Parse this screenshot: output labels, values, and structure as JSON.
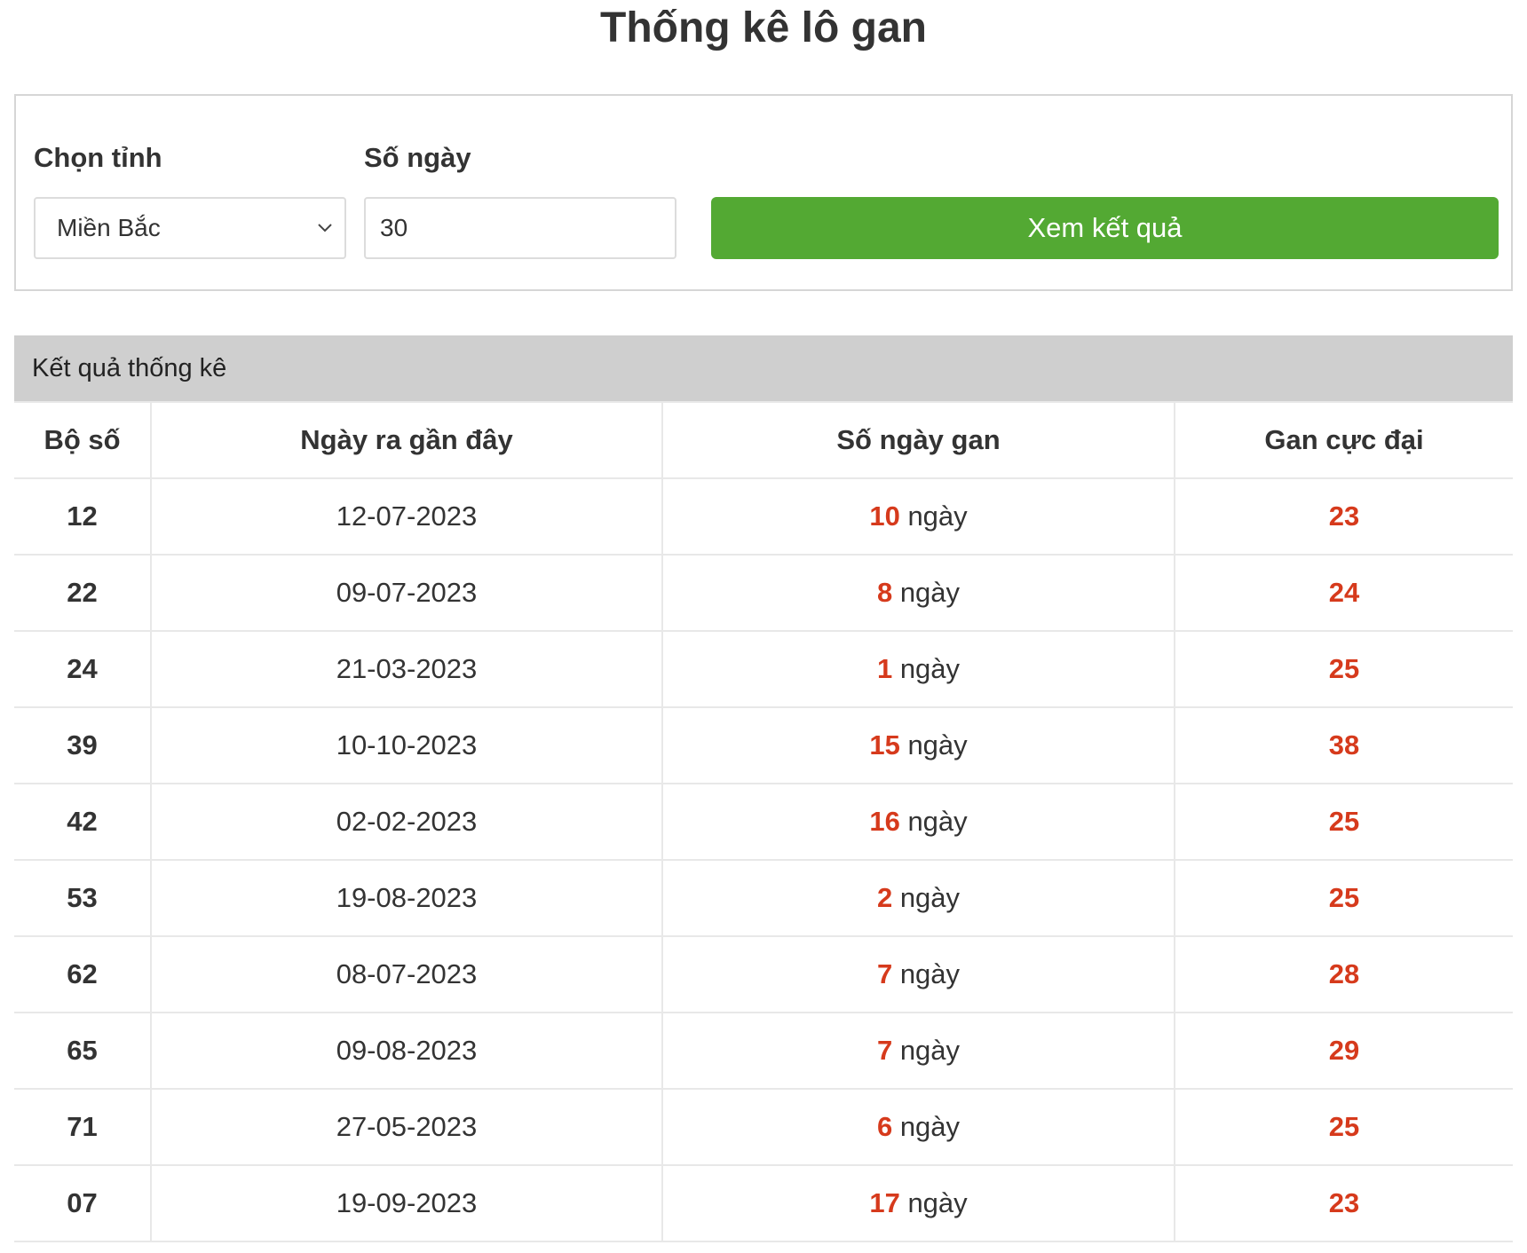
{
  "page": {
    "title": "Thống kê lô gan"
  },
  "filters": {
    "province_label": "Chọn tỉnh",
    "province_value": "Miền Bắc",
    "days_label": "Số ngày",
    "days_value": "30",
    "submit_label": "Xem kết quả"
  },
  "results": {
    "header": "Kết quả thống kê",
    "columns": [
      "Bộ số",
      "Ngày ra gần đây",
      "Số ngày gan",
      "Gan cực đại"
    ],
    "unit": "ngày",
    "rows": [
      {
        "number": "12",
        "date": "12-07-2023",
        "gan_days": "10",
        "max_gan": "23"
      },
      {
        "number": "22",
        "date": "09-07-2023",
        "gan_days": "8",
        "max_gan": "24"
      },
      {
        "number": "24",
        "date": "21-03-2023",
        "gan_days": "1",
        "max_gan": "25"
      },
      {
        "number": "39",
        "date": "10-10-2023",
        "gan_days": "15",
        "max_gan": "38"
      },
      {
        "number": "42",
        "date": "02-02-2023",
        "gan_days": "16",
        "max_gan": "25"
      },
      {
        "number": "53",
        "date": "19-08-2023",
        "gan_days": "2",
        "max_gan": "25"
      },
      {
        "number": "62",
        "date": "08-07-2023",
        "gan_days": "7",
        "max_gan": "28"
      },
      {
        "number": "65",
        "date": "09-08-2023",
        "gan_days": "7",
        "max_gan": "29"
      },
      {
        "number": "71",
        "date": "27-05-2023",
        "gan_days": "6",
        "max_gan": "25"
      },
      {
        "number": "07",
        "date": "19-09-2023",
        "gan_days": "17",
        "max_gan": "23"
      }
    ]
  },
  "colors": {
    "button": "#53a933",
    "highlight": "#d63a1c",
    "header_bg": "#cfcfcf"
  },
  "icons": {
    "select_arrow": "chevron-down-icon"
  }
}
